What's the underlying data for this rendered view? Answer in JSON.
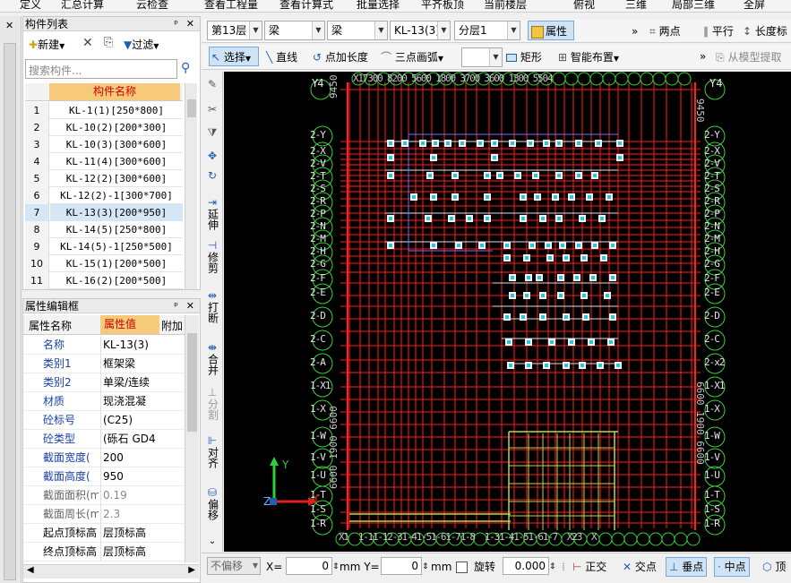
{
  "menu": [
    "定义",
    "汇总计算",
    "云检查",
    "查看工程量",
    "查看计算式",
    "批量选择",
    "平齐板顶",
    "当前楼层",
    "俯视",
    "三维",
    "局部三维",
    "全屏"
  ],
  "toolbar1": {
    "floor": "第13层",
    "category": "梁",
    "type": "梁",
    "component": "KL-13(3)",
    "layer": "分层1",
    "property_button": "属性",
    "two_point": "两点",
    "parallel": "平行",
    "length": "长度标"
  },
  "toolbar2": {
    "select": "选择",
    "line": "直线",
    "point_length": "点加长度",
    "three_point_arc": "三点画弧",
    "rect": "矩形",
    "smart_place": "智能布置",
    "from_model": "从模型提取"
  },
  "component_list": {
    "title": "构件列表",
    "new_label": "新建",
    "filter_label": "过滤",
    "search_placeholder": "搜索构件...",
    "column_header": "构件名称",
    "rows": [
      {
        "n": "1",
        "name": "KL-1(1)[250*800]"
      },
      {
        "n": "2",
        "name": "KL-10(2)[200*300]"
      },
      {
        "n": "3",
        "name": "KL-10(3)[300*600]"
      },
      {
        "n": "4",
        "name": "KL-11(4)[300*600]"
      },
      {
        "n": "5",
        "name": "KL-12(2)[300*600]"
      },
      {
        "n": "6",
        "name": "KL-12(2)-1[300*700]"
      },
      {
        "n": "7",
        "name": "KL-13(3)[200*950]"
      },
      {
        "n": "8",
        "name": "KL-14(5)[250*800]"
      },
      {
        "n": "9",
        "name": "KL-14(5)-1[250*500]"
      },
      {
        "n": "10",
        "name": "KL-15(1)[200*500]"
      },
      {
        "n": "11",
        "name": "KL-16(2)[200*500]"
      }
    ],
    "selected_index": 6
  },
  "property_editor": {
    "title": "属性编辑框",
    "col_name": "属性名称",
    "col_value": "属性值",
    "col_extra": "附加",
    "rows": [
      {
        "name": "名称",
        "value": "KL-13(3)",
        "checked": null,
        "grey": false,
        "dim": false
      },
      {
        "name": "类别1",
        "value": "框架梁",
        "checked": false,
        "grey": false,
        "dim": false
      },
      {
        "name": "类别2",
        "value": "单梁/连续",
        "checked": false,
        "grey": false,
        "dim": false
      },
      {
        "name": "材质",
        "value": "现浇混凝",
        "checked": false,
        "grey": false,
        "dim": false
      },
      {
        "name": "砼标号",
        "value": "(C25)",
        "checked": false,
        "grey": false,
        "dim": false
      },
      {
        "name": "砼类型",
        "value": "(砾石 GD4",
        "checked": false,
        "grey": false,
        "dim": false
      },
      {
        "name": "截面宽度(",
        "value": "200",
        "checked": true,
        "grey": false,
        "dim": false
      },
      {
        "name": "截面高度(",
        "value": "950",
        "checked": true,
        "grey": false,
        "dim": false
      },
      {
        "name": "截面面积(m",
        "value": "0.19",
        "checked": false,
        "grey": true,
        "dim": true
      },
      {
        "name": "截面周长(m",
        "value": "2.3",
        "checked": false,
        "grey": true,
        "dim": true
      },
      {
        "name": "起点顶标高",
        "value": "层顶标高",
        "checked": false,
        "grey": false,
        "dim": true
      },
      {
        "name": "终点顶标高",
        "value": "层顶标高",
        "checked": false,
        "grey": false,
        "dim": true
      }
    ]
  },
  "vertical_tools": [
    "延伸",
    "修剪",
    "打断",
    "合并",
    "分割",
    "对齐",
    "偏移"
  ],
  "canvas": {
    "top_axis_left": "Y4",
    "top_axis_right": "Y4",
    "top_dims": "X17300 8200 5600 1800 3700 3600 1300 5504",
    "left_dim": "9450",
    "right_dim": "9450",
    "left_bottom_dim": "6600 1900 6600",
    "right_bottom_dim": "6600 1900 6600",
    "left_axes": [
      "2-Y",
      "2-X",
      "2-V",
      "2-T",
      "2-S",
      "2-R",
      "2-P",
      "2-N",
      "2-M",
      "2-H",
      "2-G",
      "2-F",
      "2-E",
      "2-D",
      "2-C",
      "2-A",
      "1-X1",
      "1-X",
      "1-W",
      "1-V",
      "1-U",
      "1-T",
      "1-S",
      "1-R"
    ],
    "right_axes": [
      "2-Y",
      "2-X",
      "2-V",
      "2-T",
      "2-S",
      "2-R",
      "2-P",
      "2-N",
      "2-M",
      "2-H",
      "2-G",
      "2-F",
      "2-E",
      "2-D",
      "2-C",
      "2-x2",
      "1-X1",
      "1-X",
      "1-W",
      "1-V",
      "1-U",
      "1-T",
      "1-S",
      "1-R"
    ],
    "bottom_axes": "X1  1-11-12-31-41-51-61-71-8  1-31-41-51-61-7  X23  X",
    "axis_x": "X",
    "axis_y": "Y",
    "axis_z": "Z"
  },
  "status_bar": {
    "offset_mode": "不偏移",
    "x_label": "X=",
    "x_value": "0",
    "y_label": "mm Y=",
    "y_value": "0",
    "mm": "mm",
    "rotate": "旋转",
    "rotate_value": "0.000",
    "ortho": "正交",
    "intersect": "交点",
    "perpendicular": "垂点",
    "midpoint": "中点",
    "top": "顶"
  },
  "colors": {
    "canvas_bg": "#000000",
    "axis_line": "#ff2020",
    "axis_bubble": "#3ccf3c",
    "beam": "#e0e0e0",
    "selected_row": "#d5e6f7"
  }
}
